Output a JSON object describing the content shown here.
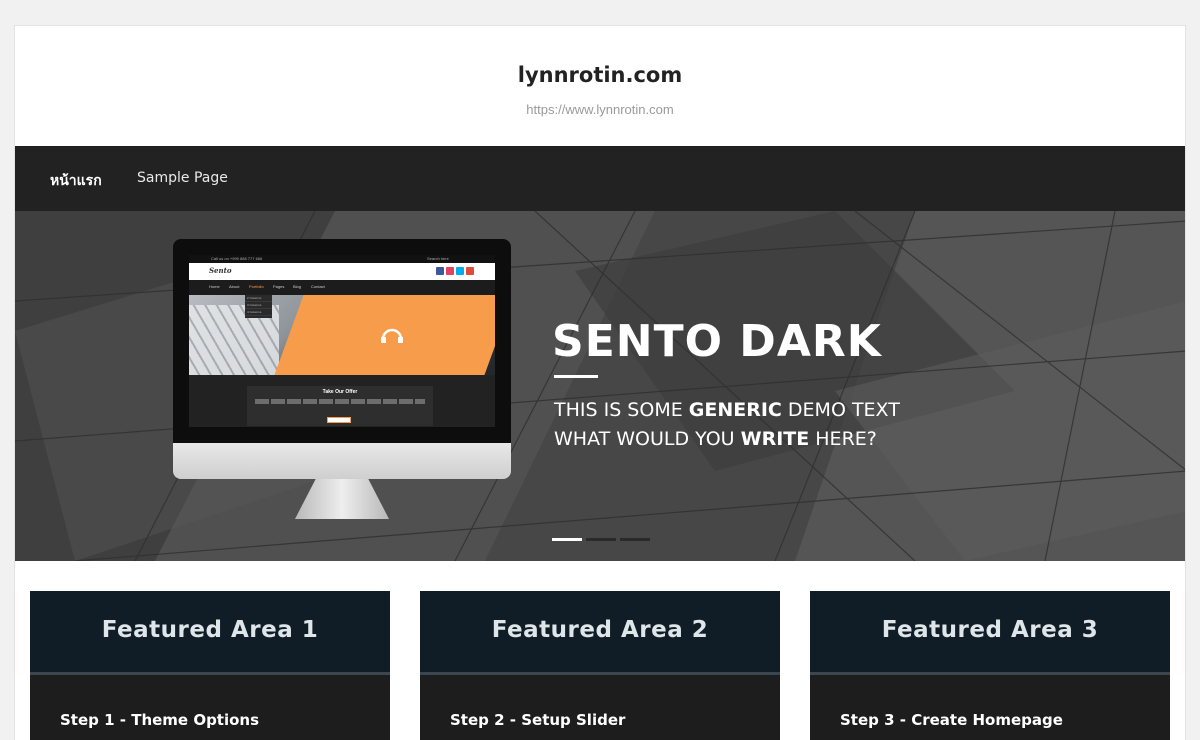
{
  "header": {
    "site_title": "lynnrotin.com",
    "site_description": "https://www.lynnrotin.com"
  },
  "nav": {
    "items": [
      {
        "label": "หน้าแรก"
      },
      {
        "label": "Sample Page"
      }
    ]
  },
  "hero": {
    "title": "SENTO DARK",
    "line1_pre": "THIS IS SOME ",
    "line1_bold": "GENERIC",
    "line1_post": " DEMO TEXT",
    "line2_pre": "WHAT WOULD YOU ",
    "line2_bold": "WRITE",
    "line2_post": " HERE?",
    "slide_count": 3,
    "active_slide": 1,
    "monitor_preview": {
      "topbar_left": "Call us on +999 888 777 666",
      "search_placeholder": "Search here",
      "logo": "Sento",
      "nav": [
        "Home",
        "About",
        "Portfolio",
        "Pages",
        "Blog",
        "Contact"
      ],
      "dropdown": [
        "2 Columns",
        "3 Columns",
        "4 Columns"
      ],
      "offer_title": "Take Our Offer",
      "offer_button": "Learn More",
      "social_colors": [
        "#3b5998",
        "#e4405f",
        "#00aced",
        "#dd4b39"
      ]
    }
  },
  "features": [
    {
      "title": "Featured Area 1",
      "step": "Step 1 - Theme Options"
    },
    {
      "title": "Featured Area 2",
      "step": "Step 2 - Setup Slider"
    },
    {
      "title": "Featured Area 3",
      "step": "Step 3 - Create Homepage"
    }
  ]
}
